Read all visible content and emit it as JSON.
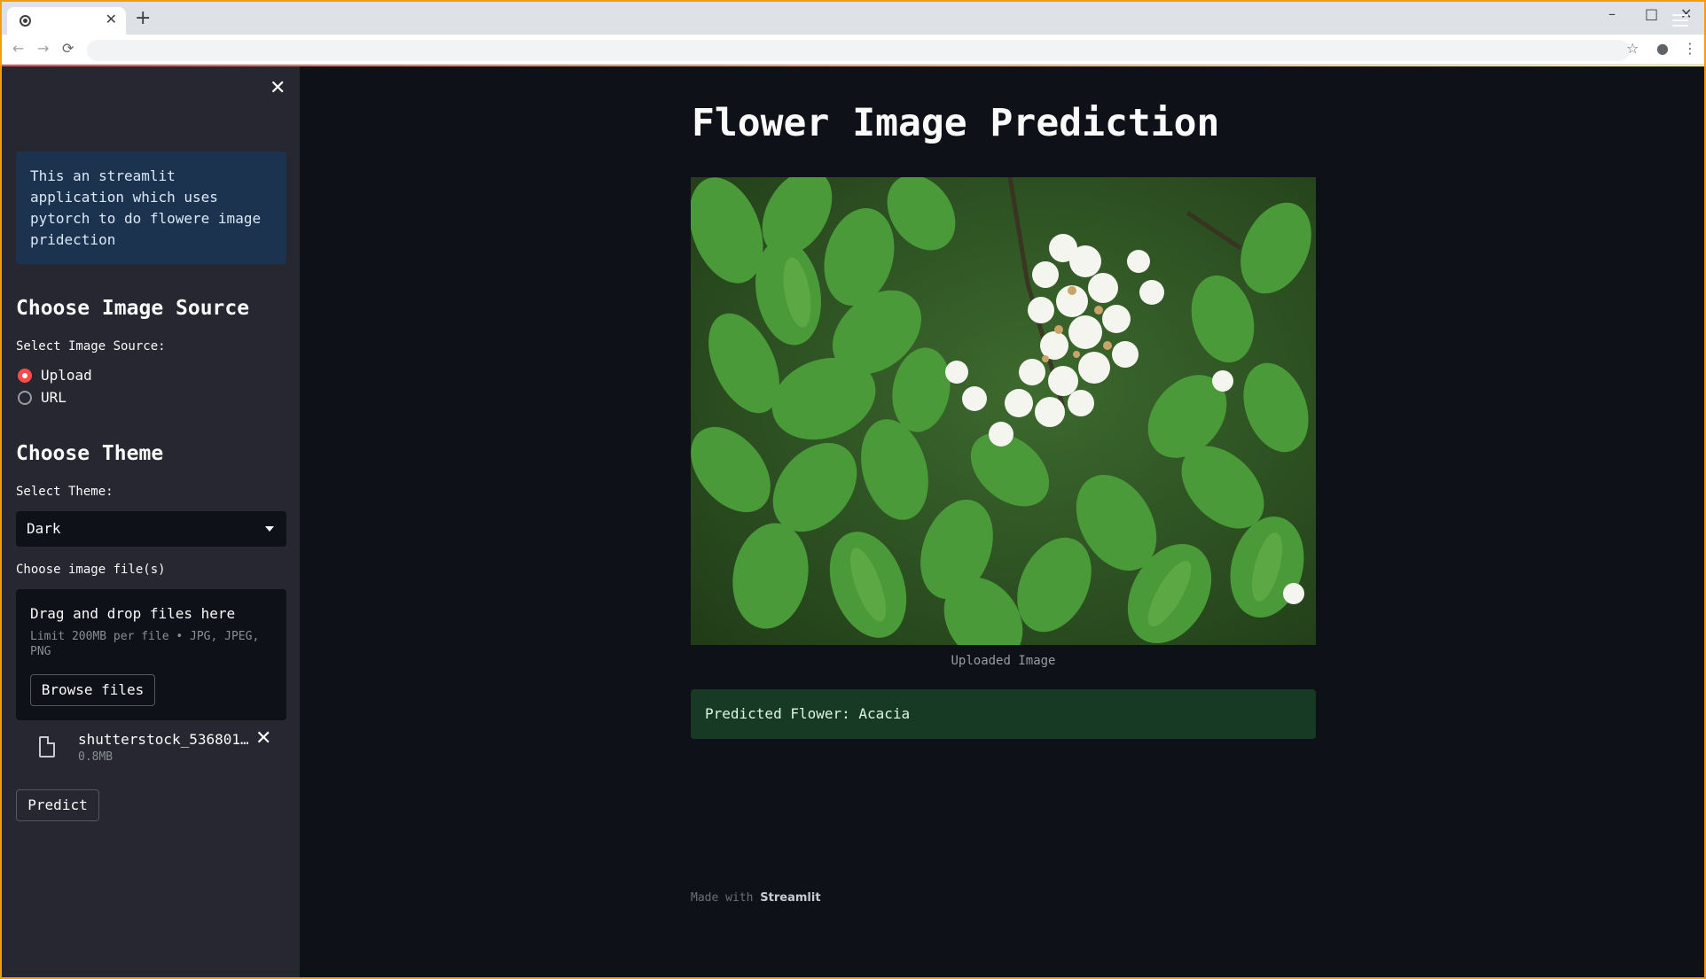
{
  "browser": {
    "new_tab": "+",
    "tab_close": "✕",
    "minimize": "–",
    "maximize": "□",
    "close": "✕",
    "back": "←",
    "forward": "→",
    "reload": "⟳",
    "star": "☆",
    "profile": "●",
    "menu": "⋮"
  },
  "sidebar": {
    "close": "✕",
    "info": "This an streamlit application which uses pytorch to do flowere image pridection",
    "image_source_heading": "Choose Image Source",
    "image_source_label": "Select Image Source:",
    "radio_options": [
      "Upload",
      "URL"
    ],
    "radio_selected": "Upload",
    "theme_heading": "Choose Theme",
    "theme_label": "Select Theme:",
    "theme_value": "Dark",
    "uploader_label": "Choose image file(s)",
    "drop_title": "Drag and drop files here",
    "drop_limit": "Limit 200MB per file • JPG, JPEG, PNG",
    "browse_button": "Browse files",
    "file_name": "shutterstock_536801…",
    "file_size": "0.8MB",
    "file_remove": "✕",
    "predict_button": "Predict"
  },
  "main": {
    "title": "Flower Image Prediction",
    "image_caption": "Uploaded Image",
    "prediction": "Predicted Flower: Acacia",
    "footer_prefix": "Made with",
    "footer_brand": "Streamlit"
  },
  "colors": {
    "accent": "#ff4b4b",
    "background": "#0e1117",
    "sidebar": "#262730",
    "info_bg": "#1c3350",
    "success_bg": "#173a25"
  }
}
